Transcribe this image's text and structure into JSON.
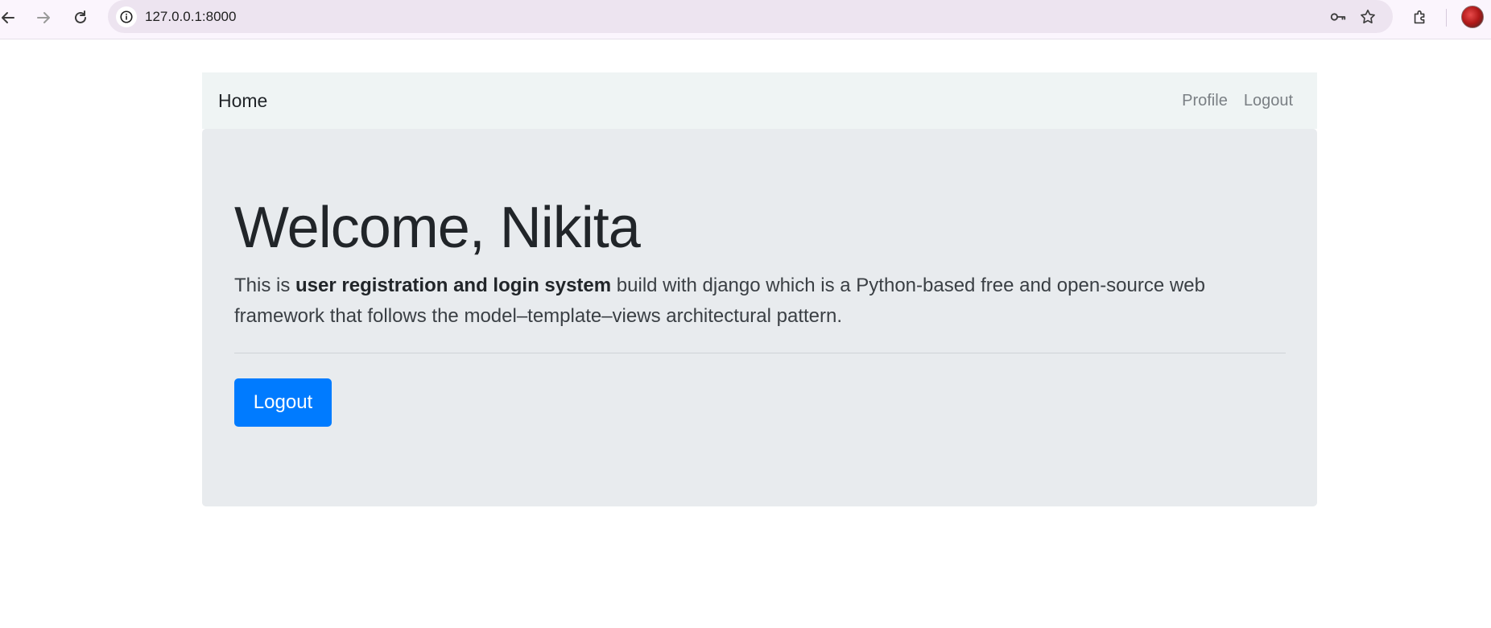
{
  "browser": {
    "url": "127.0.0.1:8000",
    "icons": {
      "back": "arrow-left-icon",
      "forward": "arrow-right-icon",
      "reload": "reload-icon",
      "site_info": "info-icon",
      "password": "key-icon",
      "bookmark": "star-icon",
      "extensions": "puzzle-icon",
      "profile": "avatar"
    }
  },
  "navbar": {
    "brand": "Home",
    "links": [
      {
        "label": "Profile"
      },
      {
        "label": "Logout"
      }
    ]
  },
  "jumbotron": {
    "title": "Welcome, Nikita",
    "lead_prefix": "This is ",
    "lead_strong": "user registration and login system",
    "lead_suffix": " build with django which is a Python-based free and open-source web framework that follows the model–template–views architectural pattern.",
    "button_label": "Logout"
  },
  "colors": {
    "primary": "#007bff",
    "navbar_bg": "#eff4f4",
    "jumbotron_bg": "#e8ebee"
  }
}
